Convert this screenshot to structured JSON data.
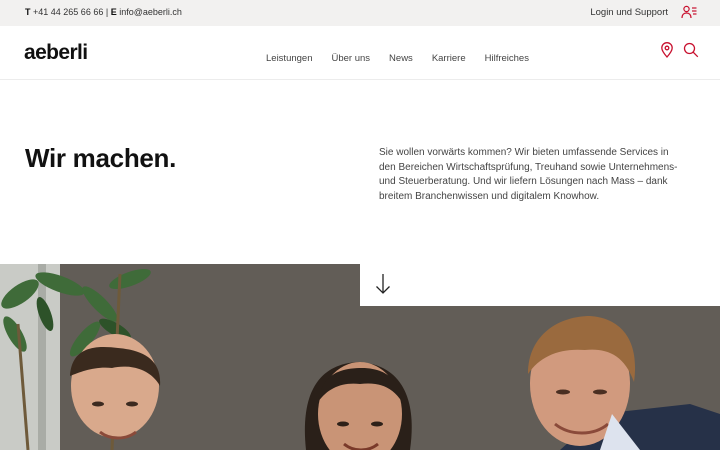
{
  "topbar": {
    "phone_prefix": "T",
    "phone": "+41 44 265 66 66",
    "separator": "|",
    "email_prefix": "E",
    "email": "info@aeberli.ch",
    "login_label": "Login und Support",
    "login_icon": "user-list-icon"
  },
  "header": {
    "logo": "aeberli",
    "nav": [
      "Leistungen",
      "Über uns",
      "News",
      "Karriere",
      "Hilfreiches"
    ],
    "icons": [
      "map-pin-icon",
      "search-icon"
    ],
    "accent_color": "#c8102e"
  },
  "hero": {
    "title": "Wir machen.",
    "text": "Sie wollen vorwärts kommen? Wir bieten umfassende Services in den Bereichen Wirtschaftsprüfung, Treuhand sowie Unternehmens- und Steuerberatung. Und wir liefern Lösungen nach Mass – dank breitem Branchenwissen und digitalem Knowhow.",
    "scroll_icon": "arrow-down-icon"
  }
}
